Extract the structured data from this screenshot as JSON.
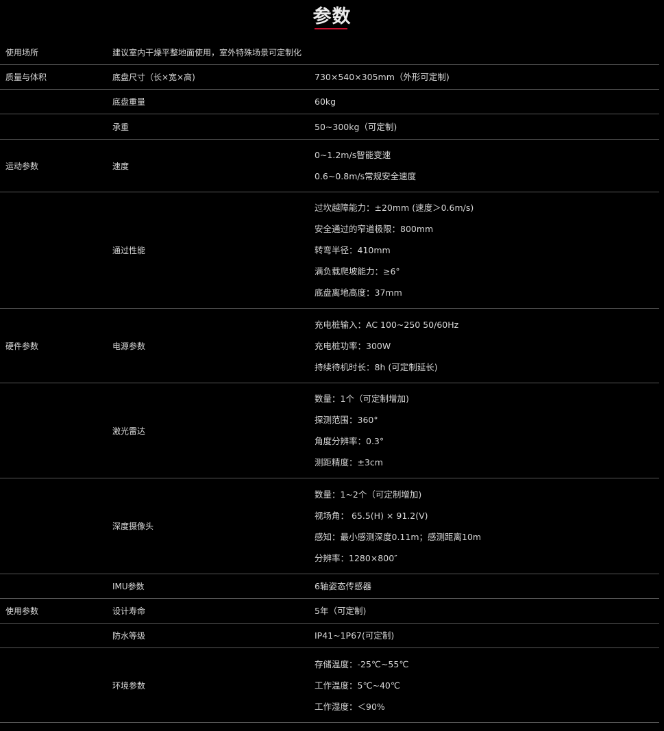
{
  "page": {
    "title": "参数"
  },
  "rows": [
    {
      "category": "使用场所",
      "description": "建议室内干燥平整地面使用，室外特殊场景可定制化"
    },
    {
      "category": "质量与体积",
      "item": "底盘尺寸（长×宽×高)",
      "values": [
        "730×540×305mm（外形可定制)"
      ]
    },
    {
      "category": "",
      "item": "底盘重量",
      "values": [
        "60kg"
      ]
    },
    {
      "category": "",
      "item": "承重",
      "values": [
        "50~300kg（可定制)"
      ]
    },
    {
      "category": "运动参数",
      "item": "速度",
      "values": [
        "0~1.2m/s智能变速",
        "0.6~0.8m/s常规安全速度"
      ]
    },
    {
      "category": "",
      "item": "通过性能",
      "values": [
        "过坎越障能力：±20mm (速度＞0.6m/s)",
        "安全通过的窄道极限：800mm",
        "转弯半径：410mm",
        "满负载爬坡能力：≥6°",
        "底盘离地高度：37mm"
      ]
    },
    {
      "category": "硬件参数",
      "item": "电源参数",
      "values": [
        "充电桩输入：AC 100~250 50/60Hz",
        "充电桩功率：300W",
        "持续待机时长：8h (可定制延长)"
      ]
    },
    {
      "category": "",
      "item": "激光雷达",
      "values": [
        "数量：1个（可定制增加)",
        "探测范围：360°",
        "角度分辨率：0.3°",
        "测距精度：±3cm"
      ]
    },
    {
      "category": "",
      "item": "深度摄像头",
      "values": [
        "数量：1~2个（可定制增加)",
        "视场角： 65.5(H) × 91.2(V)",
        "感知：最小感测深度0.11m；感测距离10m",
        "分辨率：1280×800″"
      ]
    },
    {
      "category": "",
      "item": "IMU参数",
      "values": [
        "6轴姿态传感器"
      ]
    },
    {
      "category": "使用参数",
      "item": "设计寿命",
      "values": [
        "5年（可定制)"
      ]
    },
    {
      "category": "",
      "item": "防水等级",
      "values": [
        "IP41~1P67(可定制)"
      ]
    },
    {
      "category": "",
      "item": "环境参数",
      "values": [
        "存储温度：-25℃~55℃",
        "工作温度：5℃~40℃",
        "工作湿度：＜90%"
      ]
    }
  ]
}
